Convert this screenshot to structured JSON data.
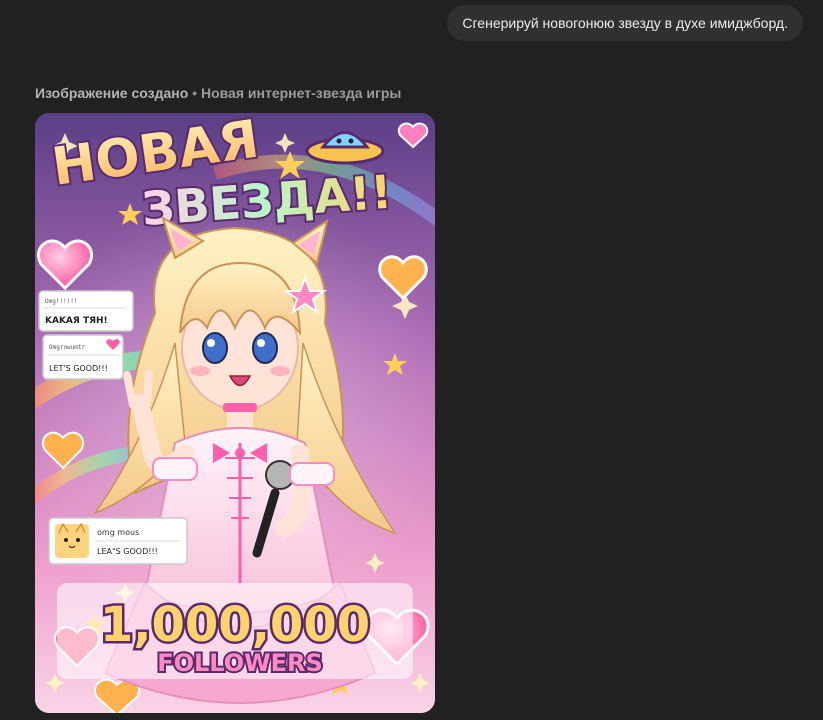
{
  "user_message": "Сгенерируй новогонюю звезду в духе имиджборд.",
  "caption": {
    "status": "Изображение создано",
    "separator": "•",
    "title": "Новая интернет-звезда игры"
  },
  "artwork": {
    "headline_line1": "НОВАЯ",
    "headline_line2": "ЗВЕЗДА!!",
    "comment1_user": "Omg!!!!!!",
    "comment1_text": "KAKAЯ ТЯН!",
    "comment2_user": "Omgrowumtr",
    "comment2_text": "LET'S GOOD!!!",
    "comment3_user": "omg mous",
    "comment3_text": "LEA\"S GOOD!!!",
    "follower_count": "1,000,000",
    "follower_label": "FOLLOWERS",
    "colors": {
      "pink": "#ff5fa8",
      "title_fill": "#ffe7b0",
      "outline": "#5b2a6e"
    }
  }
}
